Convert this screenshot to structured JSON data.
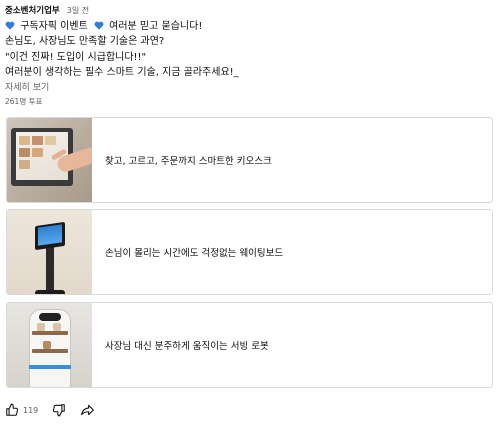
{
  "post": {
    "channel": "중소벤처기업부",
    "time": "3일 전",
    "lines": {
      "line1_a": "구독자픽 이벤트",
      "line1_b": "여러분 믿고 묻습니다!",
      "line2": "손님도, 사장님도 만족할 기술은 과연?",
      "line3": "\"이건 진짜! 도입이 시급합니다!!\"",
      "line4": "여러분이 생각하는 필수 스마트 기술, 지금 골라주세요!_"
    },
    "more": "자세히 보기",
    "votes": "261명 투표"
  },
  "poll": {
    "options": [
      {
        "label": "찾고, 고르고, 주문까지 스마트한 키오스크",
        "image": "kiosk-photo"
      },
      {
        "label": "손님이 몰리는 시간에도 걱정없는 웨이팅보드",
        "image": "waiting-board-photo"
      },
      {
        "label": "사장님 대신 분주하게 움직이는 서빙 로봇",
        "image": "serving-robot-photo"
      }
    ]
  },
  "actions": {
    "like_count": "119",
    "icons": [
      "thumbs-up-icon",
      "thumbs-down-icon",
      "share-icon"
    ]
  },
  "colors": {
    "heart": "#2f7fd6",
    "secondary_text": "#606060",
    "border": "#dadada"
  }
}
